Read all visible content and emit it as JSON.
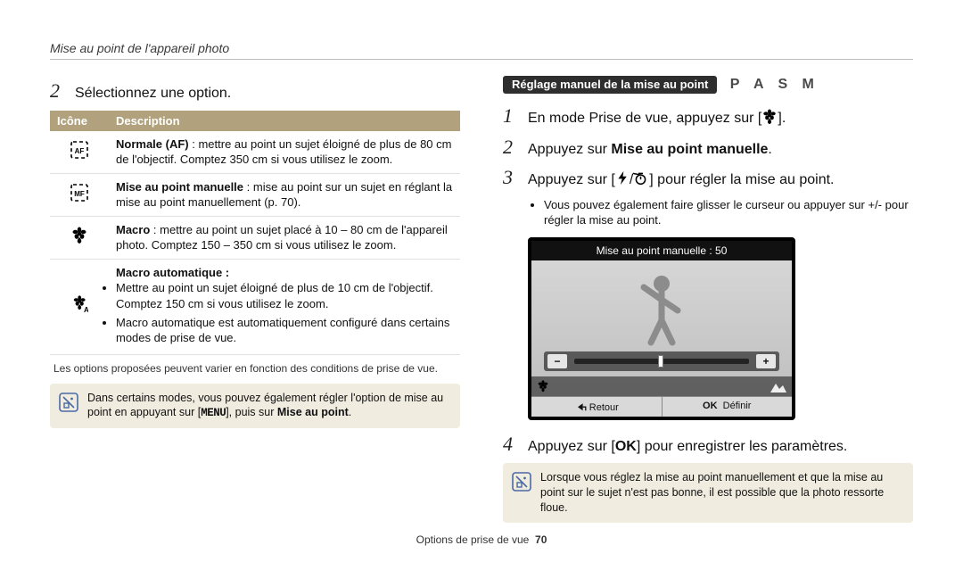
{
  "header": {
    "running": "Mise au point de l'appareil photo"
  },
  "left": {
    "step2_num": "2",
    "step2_text": "Sélectionnez une option.",
    "table": {
      "h1": "Icône",
      "h2": "Description",
      "r1": "Normale (AF) : mettre au point un sujet éloigné de plus de 80 cm de l'objectif. Comptez 350 cm si vous utilisez le zoom.",
      "r1_lead": "Normale (AF)",
      "r2": "Mise au point manuelle : mise au point sur un sujet en réglant la mise au point manuellement (p. 70).",
      "r2_lead": "Mise au point manuelle",
      "r3": "Macro : mettre au point un sujet placé à 10 – 80 cm de l'appareil photo. Comptez 150 – 350 cm si vous utilisez le zoom.",
      "r3_lead": "Macro",
      "r4_lead": "Macro automatique :",
      "r4_b1": "Mettre au point un sujet éloigné de plus de 10 cm de l'objectif. Comptez 150 cm si vous utilisez le zoom.",
      "r4_b2": "Macro automatique est automatiquement configuré dans certains modes de prise de vue."
    },
    "varynote": "Les options proposées peuvent varier en fonction des conditions de prise de vue.",
    "infobox_pre": "Dans certains modes, vous pouvez également régler l'option de mise au point en appuyant sur [",
    "infobox_menu": "MENU",
    "infobox_mid": "], puis sur ",
    "infobox_bold": "Mise au point",
    "infobox_post": "."
  },
  "right": {
    "pill": "Réglage manuel de la mise au point",
    "modes": "P A S M",
    "s1_num": "1",
    "s1_text_pre": "En mode Prise de vue, appuyez sur [",
    "s1_text_post": "].",
    "s2_num": "2",
    "s2_pre": "Appuyez sur ",
    "s2_bold": "Mise au point manuelle",
    "s2_post": ".",
    "s3_num": "3",
    "s3_pre": "Appuyez sur [",
    "s3_mid": "/",
    "s3_post": "] pour régler la mise au point.",
    "s3_sub": "Vous pouvez également faire glisser le curseur ou appuyer sur +/- pour régler la mise au point.",
    "lcd_title": "Mise au point manuelle : 50",
    "lcd_back": "Retour",
    "lcd_set": "Définir",
    "lcd_ok": "OK",
    "s4_num": "4",
    "s4_pre": "Appuyez sur [",
    "s4_ok": "OK",
    "s4_post": "] pour enregistrer les paramètres.",
    "info2": "Lorsque vous réglez la mise au point manuellement et que la mise au point sur le sujet n'est pas bonne, il est possible que la photo ressorte floue."
  },
  "footer": {
    "section": "Options de prise de vue",
    "page": "70"
  }
}
